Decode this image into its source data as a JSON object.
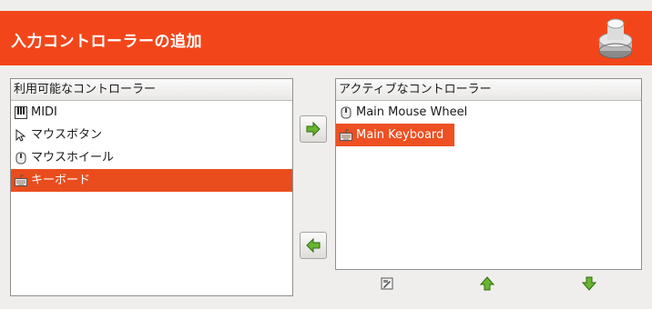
{
  "header": {
    "title": "入力コントローラーの追加",
    "icon": "controller-icon"
  },
  "available": {
    "column_header": "利用可能なコントローラー",
    "items": [
      {
        "label": "MIDI",
        "icon": "piano-keys-icon"
      },
      {
        "label": "マウスボタン",
        "icon": "mouse-pointer-icon"
      },
      {
        "label": "マウスホイール",
        "icon": "mouse-wheel-icon"
      },
      {
        "label": "キーボード",
        "icon": "keyboard-icon",
        "selected": true
      }
    ]
  },
  "active": {
    "column_header": "アクティブなコントローラー",
    "items": [
      {
        "label": "Main Mouse Wheel",
        "icon": "mouse-wheel-icon"
      },
      {
        "label": "Main Keyboard",
        "icon": "keyboard-icon",
        "selected": true
      }
    ]
  },
  "buttons": {
    "add": "arrow-right-icon",
    "remove": "arrow-left-icon",
    "edit": "edit-icon",
    "move_up": "arrow-up-icon",
    "move_down": "arrow-down-icon"
  },
  "colors": {
    "accent": "#f2461a",
    "selection": "#e94d1d",
    "button_green": "#5aa52a"
  }
}
